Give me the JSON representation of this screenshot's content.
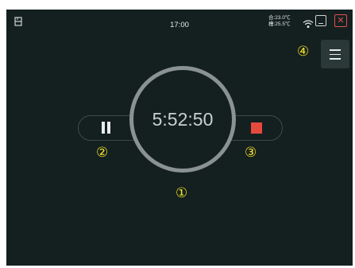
{
  "statusbar": {
    "clock": "17:00",
    "temp_line1": "合:23.0℃",
    "temp_line2": "槽:25.5℃",
    "close_glyph": "✕"
  },
  "timer": {
    "display": "5:52:50"
  },
  "annotations": {
    "a1": "①",
    "a2": "②",
    "a3": "③",
    "a4": "④"
  },
  "colors": {
    "background": "#14201f",
    "stop": "#e54a3d",
    "annotation": "#f3e12a",
    "close": "#e05050"
  },
  "icons": {
    "status_left": "device-icon",
    "wifi": "wifi-icon",
    "minimize": "minimize-icon",
    "close": "close-icon",
    "menu": "menu-icon",
    "pause": "pause-icon",
    "stop": "stop-icon"
  }
}
